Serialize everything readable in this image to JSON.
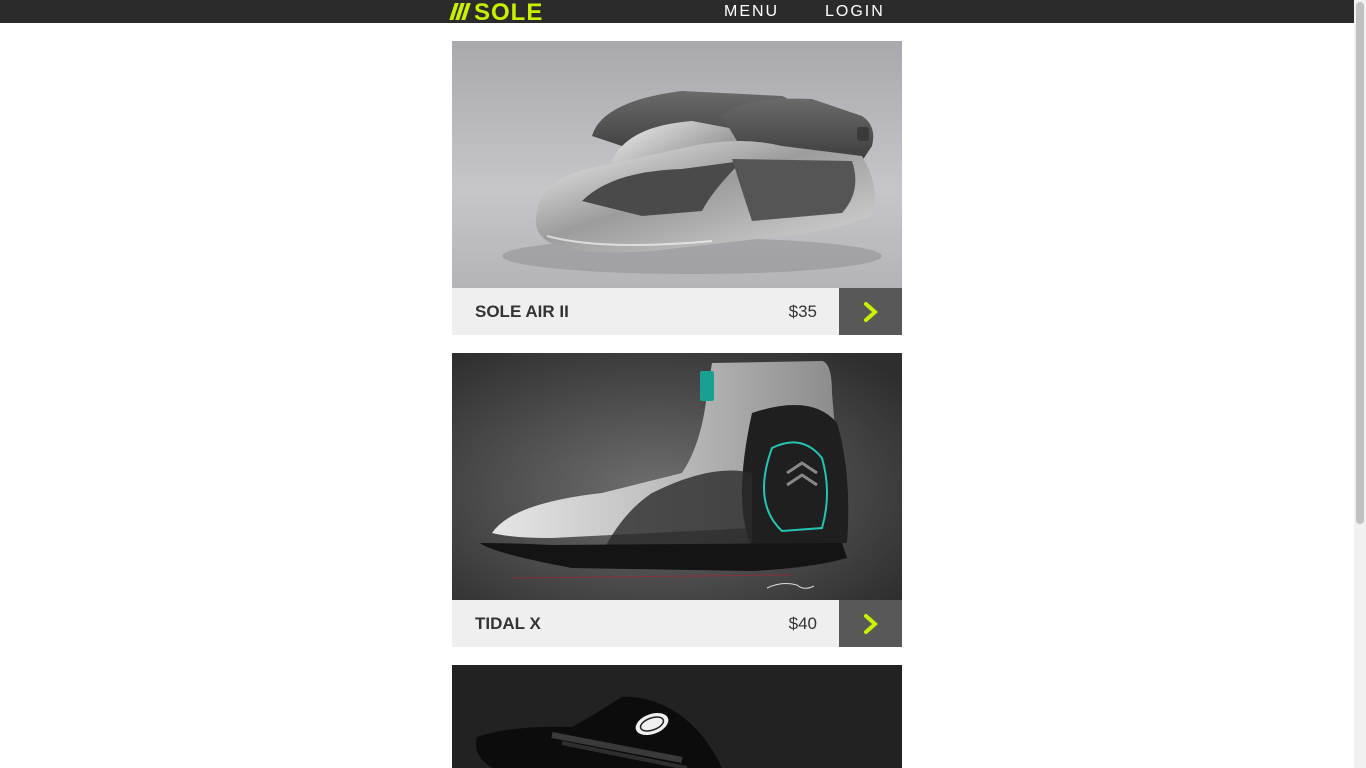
{
  "brand": {
    "name": "SOLE",
    "accent_color": "#c8f000",
    "icon": "logo-slashes-icon"
  },
  "nav": {
    "menu_label": "MENU",
    "login_label": "LOGIN"
  },
  "products": [
    {
      "name": "SOLE AIR II",
      "price": "$35",
      "action_icon": "chevron-right-icon"
    },
    {
      "name": "TIDAL X",
      "price": "$40",
      "action_icon": "chevron-right-icon"
    },
    {
      "name": "",
      "price": "",
      "action_icon": "chevron-right-icon"
    }
  ]
}
